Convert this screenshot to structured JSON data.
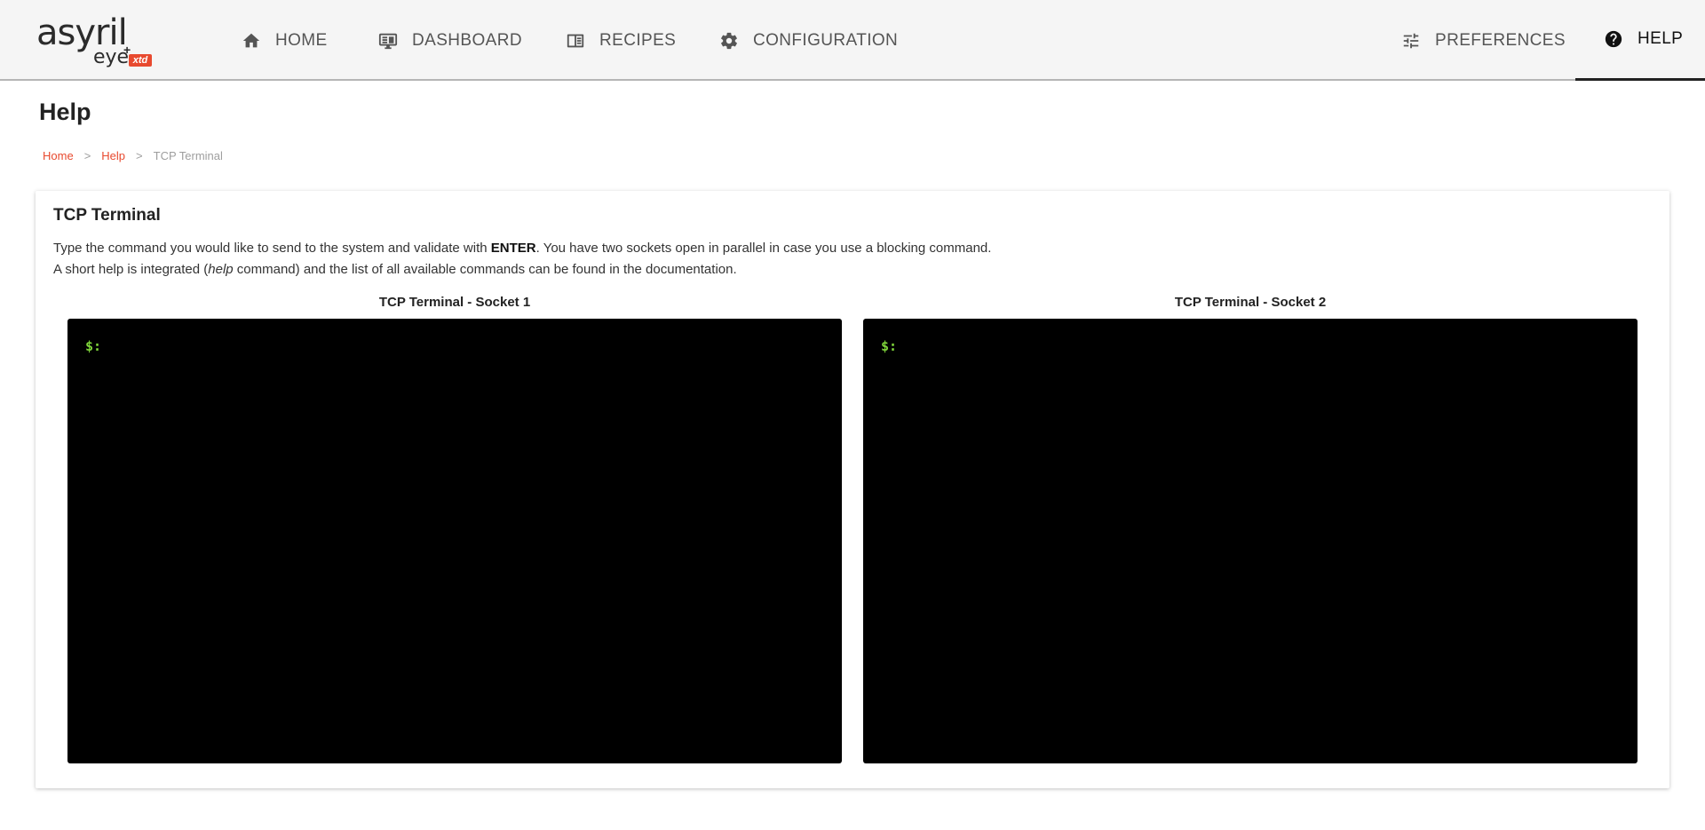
{
  "brand": {
    "main": "asyril",
    "sub": "eye",
    "plus": "+",
    "edition": "xtd"
  },
  "nav": {
    "home": "HOME",
    "dashboard": "DASHBOARD",
    "recipes": "RECIPES",
    "configuration": "CONFIGURATION",
    "preferences": "PREFERENCES",
    "help": "HELP",
    "active": "help"
  },
  "page": {
    "title": "Help"
  },
  "breadcrumb": {
    "items": [
      "Home",
      "Help",
      "TCP Terminal"
    ],
    "separator": ">"
  },
  "card": {
    "title": "TCP Terminal",
    "line1_a": "Type the command you would like to send to the system and validate with ",
    "line1_key": "ENTER",
    "line1_b": ". You have two sockets open in parallel in case you use a blocking command.",
    "line2_a": "A short help is integrated (",
    "line2_cmd": "help",
    "line2_b": " command) and the list of all available commands can be found in the documentation."
  },
  "terminals": [
    {
      "label": "TCP Terminal - Socket 1",
      "prompt": "$:"
    },
    {
      "label": "TCP Terminal - Socket 2",
      "prompt": "$:"
    }
  ],
  "colors": {
    "accent": "#e84a2f",
    "prompt": "#7fd63a",
    "terminal_bg": "#000000",
    "topbar_bg": "#f5f5f5"
  }
}
